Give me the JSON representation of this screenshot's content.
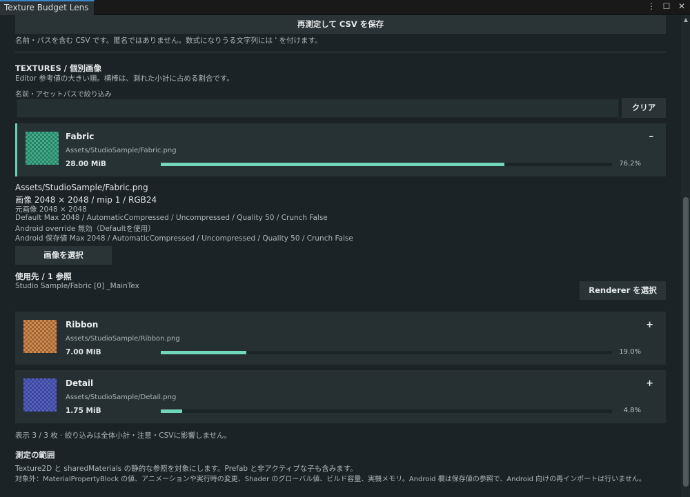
{
  "window": {
    "tab_title": "Texture Budget Lens",
    "icons": [
      "menu-dots-icon",
      "maximize-icon",
      "close-icon"
    ]
  },
  "toolbar": {
    "remeasure_csv_label": "再測定して CSV を保存",
    "csv_note": "名前・パスを含む CSV です。匿名ではありません。数式になりうる文字列には ' を付けます。"
  },
  "textures": {
    "heading": "TEXTURES  /  個別画像",
    "subheading": "Editor 参考値の大きい順。横棒は、測れた小計に占める割合です。",
    "filter_label": "名前・アセットパスで絞り込み",
    "filter_value": "",
    "clear_label": "クリア"
  },
  "items": [
    {
      "name": "Fabric",
      "path": "Assets/StudioSample/Fabric.png",
      "size": "28.00 MiB",
      "percent_label": "76.2%",
      "fraction": 0.762,
      "toggle": "–",
      "color": "#3fae8a"
    },
    {
      "name": "Ribbon",
      "path": "Assets/StudioSample/Ribbon.png",
      "size": "7.00 MiB",
      "percent_label": "19.0%",
      "fraction": 0.19,
      "toggle": "+",
      "color": "#d48a4d"
    },
    {
      "name": "Detail",
      "path": "Assets/StudioSample/Detail.png",
      "size": "1.75 MiB",
      "percent_label": "4.8%",
      "fraction": 0.048,
      "toggle": "+",
      "color": "#5561c8"
    }
  ],
  "detail": {
    "path": "Assets/StudioSample/Fabric.png",
    "image_line": "画像  2048 × 2048  /  mip 1  /  RGB24",
    "source_line": "元画像  2048 × 2048",
    "default_line": "Default  Max 2048 / AutomaticCompressed / Uncompressed / Quality 50 / Crunch False",
    "android_override_line": "Android override  無効（Defaultを使用）",
    "android_saved_line": "Android 保存値  Max 2048 / AutomaticCompressed / Uncompressed / Quality 50 / Crunch False",
    "select_image_label": "画像を選択",
    "usage_heading": "使用先  /  1 参照",
    "usage_item": "Studio Sample/Fabric [0] _MainTex",
    "select_renderer_label": "Renderer を選択"
  },
  "footer": {
    "count_note": "表示 3 / 3 枚  ·  絞り込みは全体小計・注意・CSVに影響しません。",
    "scope_heading": "測定の範囲",
    "scope_line1": "Texture2D と sharedMaterials の静的な参照を対象にします。Prefab と非アクティブな子も含みます。",
    "scope_line2": "対象外：MaterialPropertyBlock の値、アニメーションや実行時の変更、Shader のグローバル値、ビルド容量、実機メモリ。Android 欄は保存値の参照で、Android 向けの再インポートは行いません。"
  }
}
